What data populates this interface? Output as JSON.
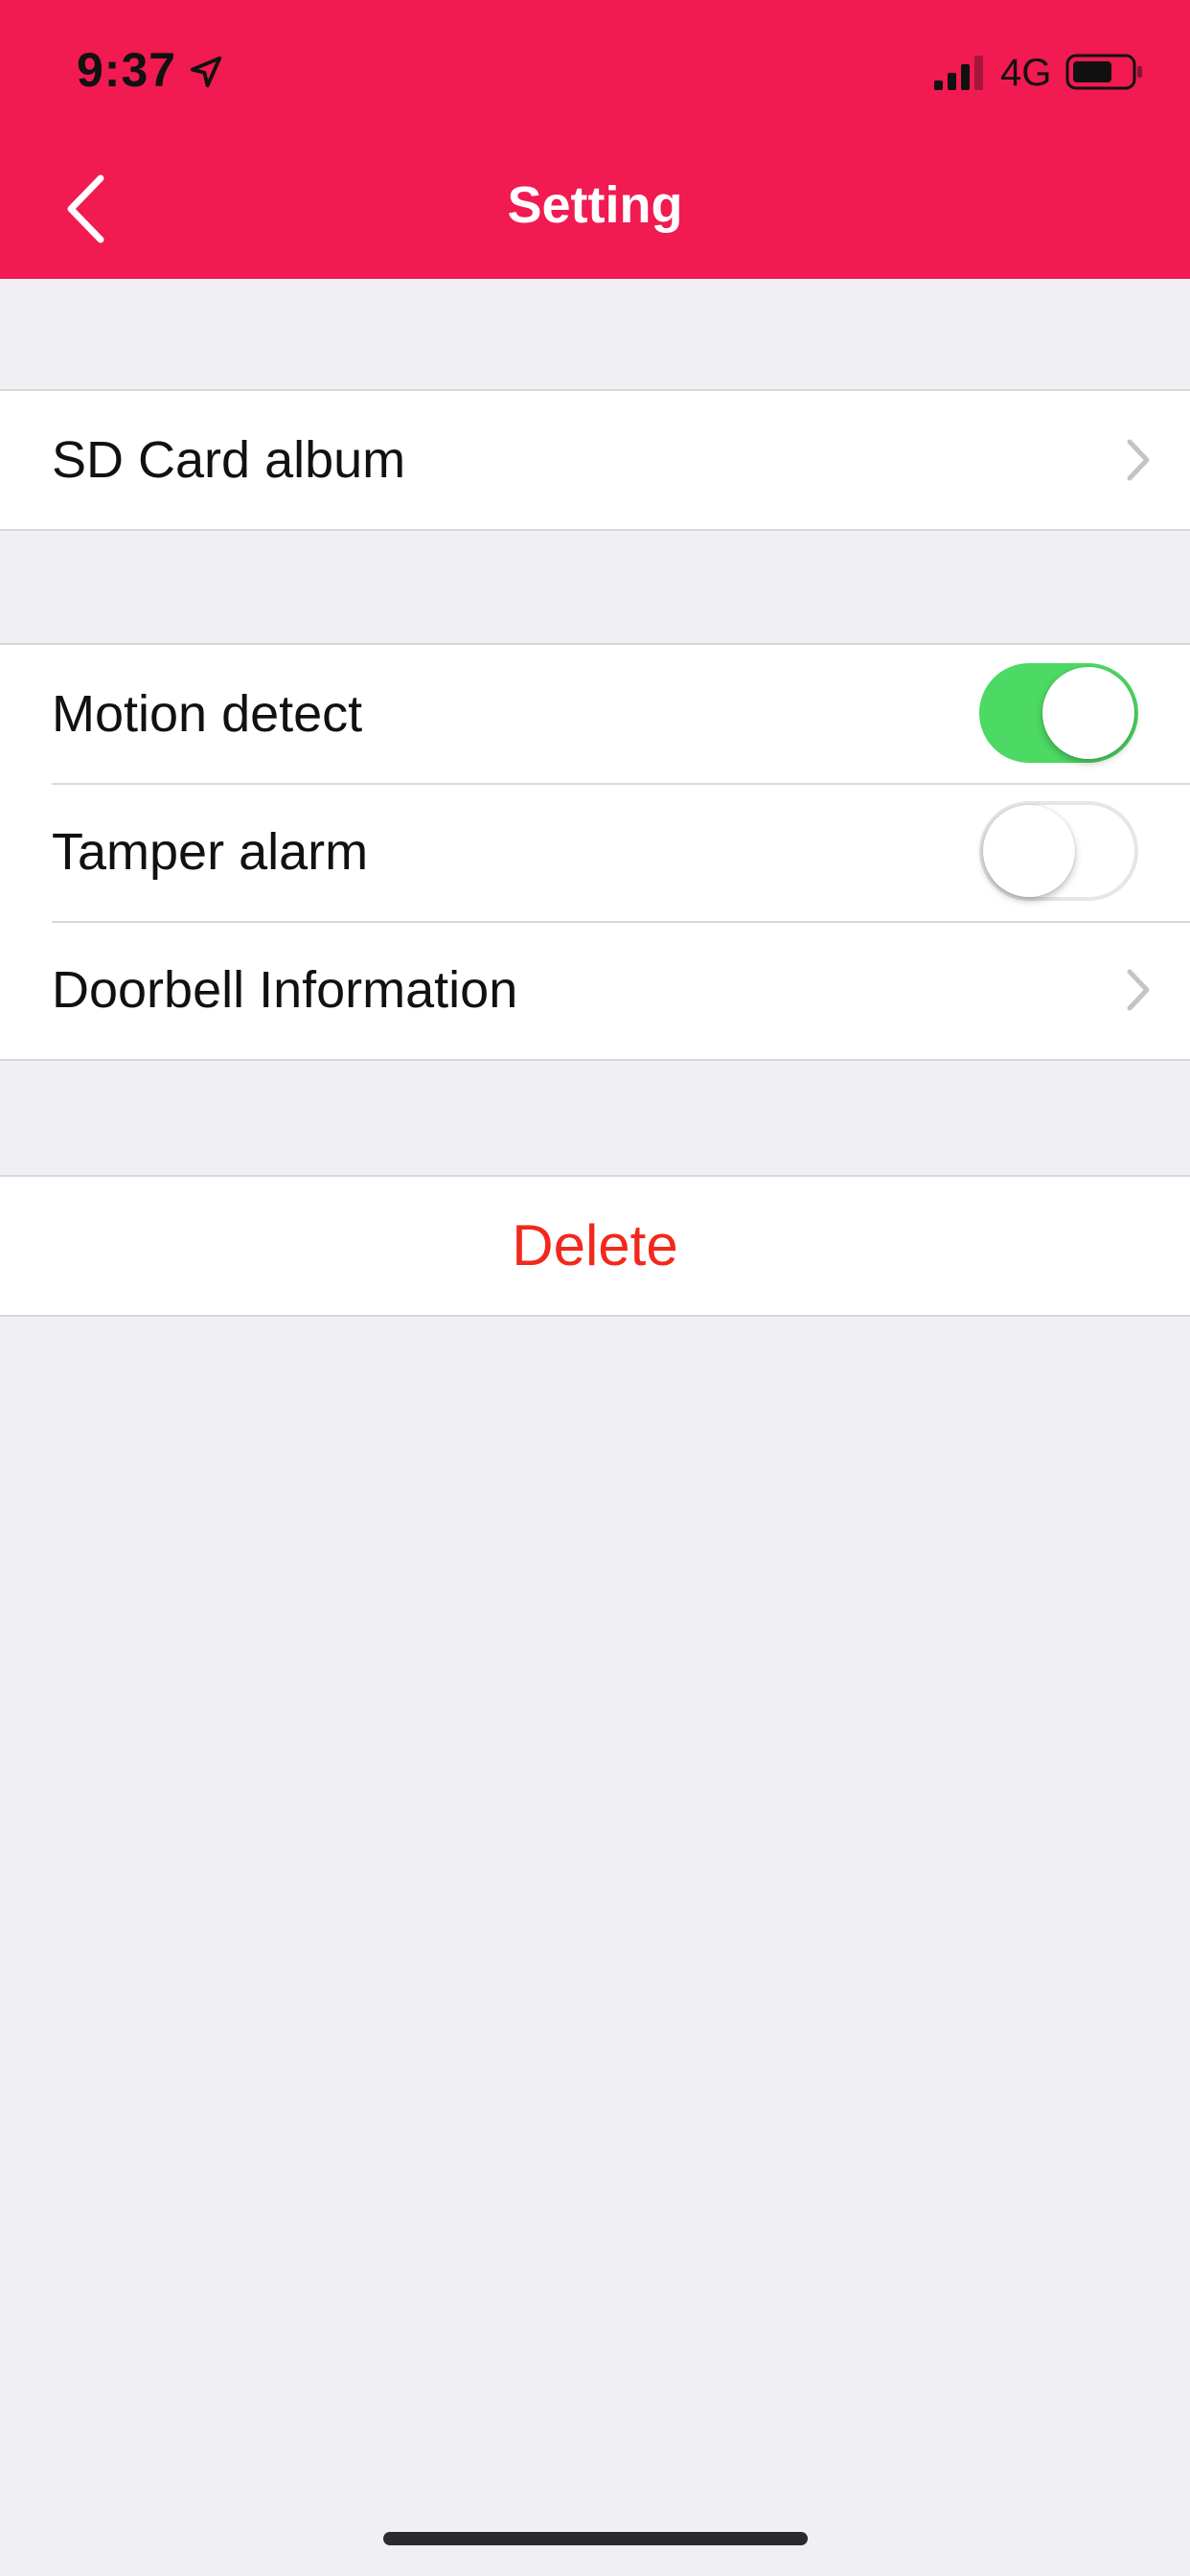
{
  "status_bar": {
    "time": "9:37",
    "network": "4G",
    "location_icon": "location-arrow-icon",
    "signal_icon": "cellular-signal-icon",
    "battery_icon": "battery-icon"
  },
  "nav": {
    "title": "Setting",
    "back_icon": "chevron-left-icon"
  },
  "sections": {
    "storage": {
      "sd_card_album_label": "SD Card album"
    },
    "device": {
      "motion_detect_label": "Motion detect",
      "motion_detect_enabled": true,
      "tamper_alarm_label": "Tamper alarm",
      "tamper_alarm_enabled": false,
      "doorbell_information_label": "Doorbell Information"
    },
    "danger": {
      "delete_label": "Delete"
    }
  },
  "colors": {
    "header_background": "#f11a51",
    "toggle_on": "#4cd964",
    "delete_text": "#f2281c",
    "page_background": "#efeff4"
  }
}
